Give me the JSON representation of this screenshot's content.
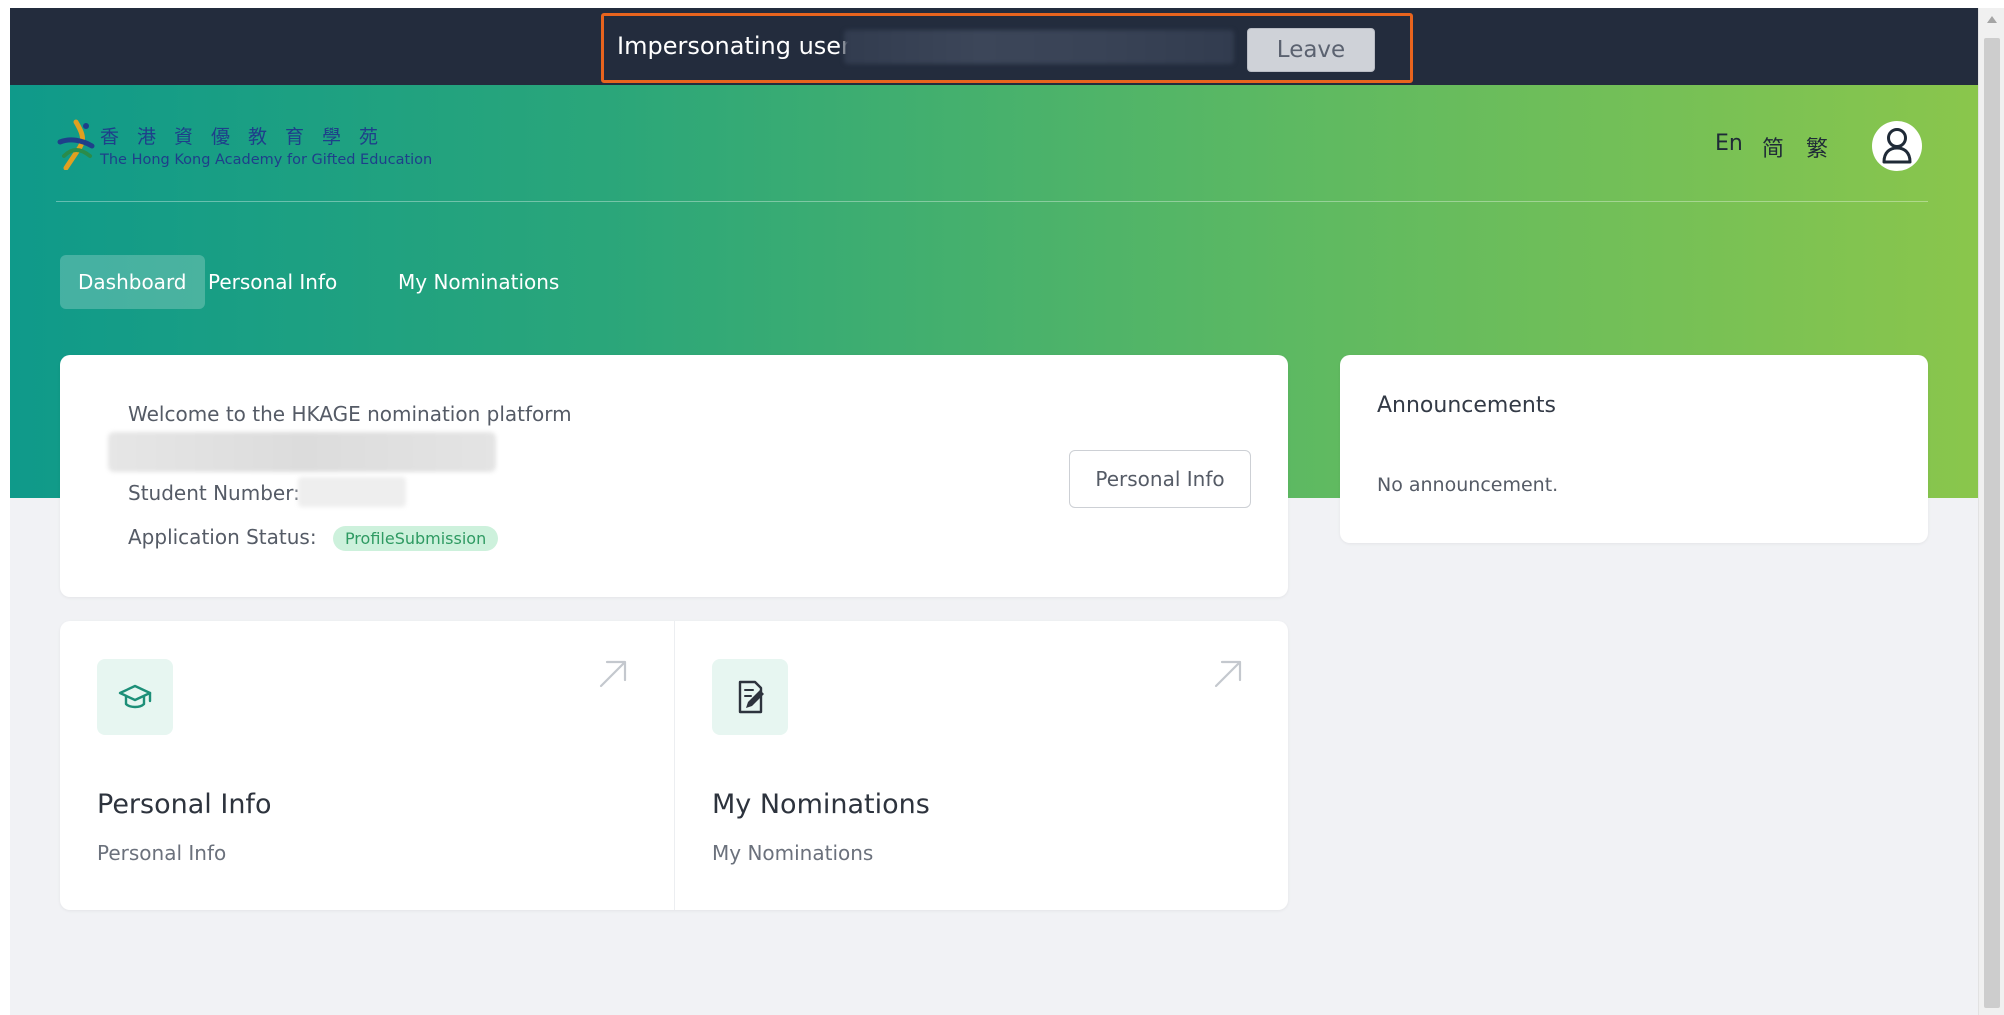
{
  "impersonation": {
    "label": "Impersonating user",
    "leave_label": "Leave"
  },
  "brand": {
    "name_cn": "香港資優教育學苑",
    "name_en": "The Hong Kong Academy for Gifted Education"
  },
  "languages": [
    "En",
    "简",
    "繁"
  ],
  "nav": {
    "items": [
      "Dashboard",
      "Personal Info",
      "My Nominations"
    ],
    "active": "Dashboard"
  },
  "welcome": {
    "greeting": "Welcome to the HKAGE nomination platform",
    "student_number_label": "Student Number:",
    "status_label": "Application Status:",
    "status_value": "ProfileSubmission",
    "button_label": "Personal Info"
  },
  "announcements": {
    "title": "Announcements",
    "empty_text": "No announcement."
  },
  "tiles": [
    {
      "title": "Personal Info",
      "subtitle": "Personal Info",
      "icon": "graduation-cap-icon"
    },
    {
      "title": "My Nominations",
      "subtitle": "My Nominations",
      "icon": "document-edit-icon"
    }
  ],
  "colors": {
    "impersonation_bar": "#232c3d",
    "highlight_border": "#e8641e",
    "gradient_start": "#0f9a8a",
    "gradient_end": "#8ac64c",
    "status_badge_bg": "#cdf1dc",
    "status_badge_text": "#2e9a62"
  }
}
